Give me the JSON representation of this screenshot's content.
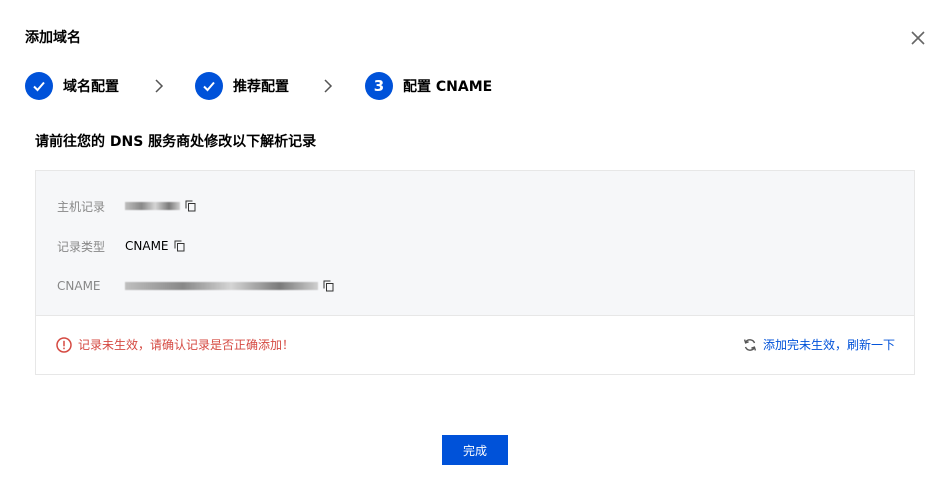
{
  "dialog": {
    "title": "添加域名",
    "close_icon": "close-icon"
  },
  "steps": [
    {
      "label": "域名配置",
      "state": "done",
      "icon": "check-icon"
    },
    {
      "label": "推荐配置",
      "state": "done",
      "icon": "check-icon"
    },
    {
      "label": "配置 CNAME",
      "state": "current",
      "number": "3"
    }
  ],
  "instruction": "请前往您的 DNS 服务商处修改以下解析记录",
  "records": {
    "host_label": "主机记录",
    "type_label": "记录类型",
    "type_value": "CNAME",
    "cname_label": "CNAME"
  },
  "status": {
    "error_text": "记录未生效，请确认记录是否正确添加！",
    "refresh_text": "添加完未生效，刷新一下"
  },
  "footer": {
    "done_label": "完成"
  },
  "colors": {
    "primary": "#0052d9",
    "error": "#d54941",
    "card_bg": "#f6f7f9",
    "border": "#e7e7e7"
  }
}
